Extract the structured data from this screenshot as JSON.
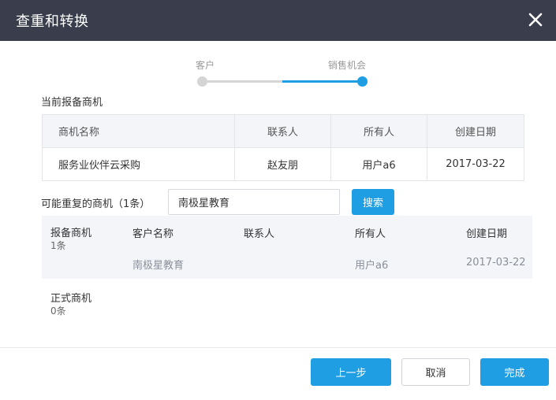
{
  "dialog": {
    "title": "查重和转换",
    "close_icon": "close-icon"
  },
  "stepper": {
    "steps": [
      {
        "label": "客户",
        "state": "done"
      },
      {
        "label": "销售机会",
        "state": "active"
      }
    ],
    "active_color": "#1f9ee3"
  },
  "current": {
    "label": "当前报备商机",
    "headers": [
      "商机名称",
      "联系人",
      "所有人",
      "创建日期"
    ],
    "rows": [
      [
        "服务业伙伴云采购",
        "赵友朋",
        "用户a6",
        "2017-03-22"
      ]
    ]
  },
  "duplicate": {
    "label": "可能重复的商机（1条）",
    "search_value": "南极星教育",
    "search_button": "搜索",
    "groups": [
      {
        "title": "报备商机",
        "count": "1条",
        "headers": [
          "客户名称",
          "联系人",
          "所有人",
          "创建日期"
        ],
        "rows": [
          [
            "南极星教育",
            "",
            "用户a6",
            "2017-03-22"
          ]
        ]
      },
      {
        "title": "正式商机",
        "count": "0条"
      }
    ]
  },
  "footer": {
    "prev_label": "上一步",
    "cancel_label": "取消",
    "finish_label": "完成"
  }
}
